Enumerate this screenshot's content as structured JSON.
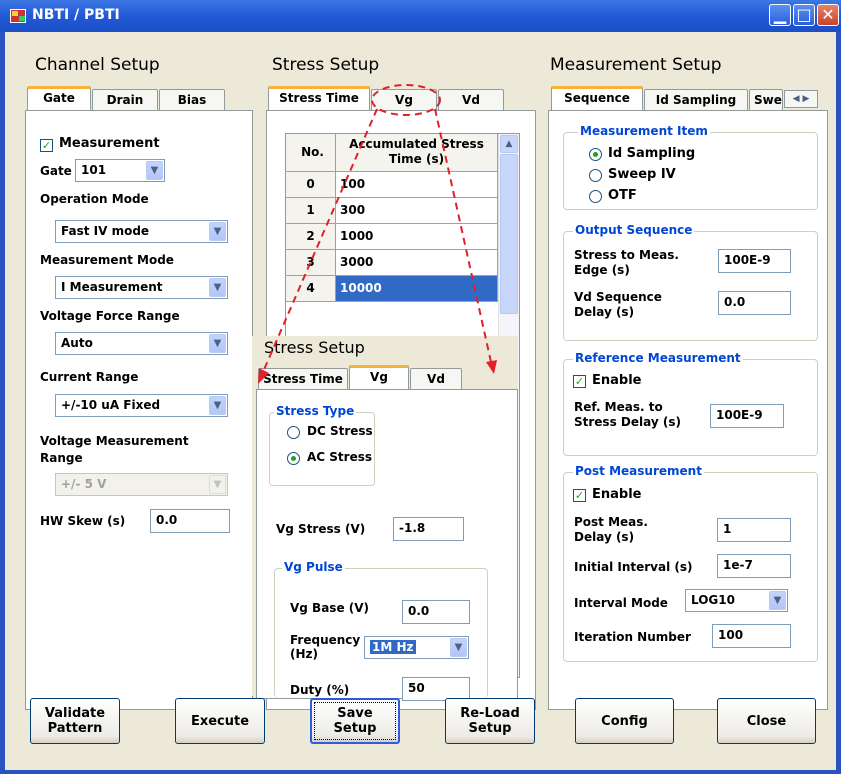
{
  "window": {
    "title": "NBTI / PBTI",
    "min_icon": "minimize-icon",
    "max_icon": "maximize-icon",
    "close_icon": "close-icon"
  },
  "channel_setup": {
    "heading": "Channel Setup",
    "tabs": [
      "Gate",
      "Drain",
      "Bias"
    ],
    "measurement_label": "Measurement",
    "measurement_checked": true,
    "gate_label": "Gate",
    "gate_value": "101",
    "operation_mode_label": "Operation Mode",
    "operation_mode_value": "Fast IV mode",
    "measurement_mode_label": "Measurement Mode",
    "measurement_mode_value": "I Measurement",
    "voltage_force_range_label": "Voltage Force Range",
    "voltage_force_range_value": "Auto",
    "current_range_label": "Current Range",
    "current_range_value": "+/-10 uA Fixed",
    "voltage_measurement_range_label": "Voltage Measurement Range",
    "voltage_measurement_range_value": "+/- 5 V",
    "hw_skew_label": "HW Skew (s)",
    "hw_skew_value": "0.0"
  },
  "stress_setup": {
    "heading": "Stress Setup",
    "tabs": [
      "Stress Time",
      "Vg",
      "Vd"
    ],
    "table": {
      "headers": [
        "No.",
        "Accumulated Stress Time (s)"
      ],
      "rows": [
        [
          "0",
          "100"
        ],
        [
          "1",
          "300"
        ],
        [
          "2",
          "1000"
        ],
        [
          "3",
          "3000"
        ],
        [
          "4",
          "10000"
        ]
      ],
      "selected_row": 4
    }
  },
  "stress_popup": {
    "heading": "Stress Setup",
    "tabs": [
      "Stress Time",
      "Vg",
      "Vd"
    ],
    "stress_type_title": "Stress Type",
    "dc_stress_label": "DC Stress",
    "ac_stress_label": "AC Stress",
    "selected": "AC Stress",
    "vg_stress_label": "Vg Stress (V)",
    "vg_stress_value": "-1.8",
    "vg_pulse_title": "Vg Pulse",
    "vg_base_label": "Vg Base (V)",
    "vg_base_value": "0.0",
    "frequency_label": "Frequency (Hz)",
    "frequency_value": "1M Hz",
    "duty_label": "Duty (%)",
    "duty_value": "50"
  },
  "measurement_setup": {
    "heading": "Measurement Setup",
    "tabs": [
      "Sequence",
      "Id Sampling",
      "Swe"
    ],
    "measurement_item_title": "Measurement Item",
    "items": [
      "Id Sampling",
      "Sweep IV",
      "OTF"
    ],
    "selected_item": "Id Sampling",
    "output_sequence_title": "Output Sequence",
    "stress_to_meas_label": "Stress to Meas. Edge (s)",
    "stress_to_meas_value": "100E-9",
    "vd_sequence_label": "Vd Sequence Delay (s)",
    "vd_sequence_value": "0.0",
    "reference_measurement_title": "Reference Measurement",
    "ref_enable_label": "Enable",
    "ref_delay_label": "Ref. Meas. to Stress Delay (s)",
    "ref_delay_value": "100E-9",
    "post_measurement_title": "Post Measurement",
    "post_enable_label": "Enable",
    "post_delay_label": "Post Meas. Delay (s)",
    "post_delay_value": "1",
    "initial_interval_label": "Initial Interval (s)",
    "initial_interval_value": "1e-7",
    "interval_mode_label": "Interval Mode",
    "interval_mode_value": "LOG10",
    "iteration_label": "Iteration Number",
    "iteration_value": "100"
  },
  "buttons": {
    "validate": "Validate Pattern",
    "execute": "Execute",
    "save": "Save Setup",
    "reload": "Re-Load Setup",
    "config": "Config",
    "close": "Close"
  },
  "colors": {
    "accent": "#f5b33c",
    "group_title": "#0046d5",
    "selection": "#316ac5",
    "annotation": "#e0202a"
  }
}
